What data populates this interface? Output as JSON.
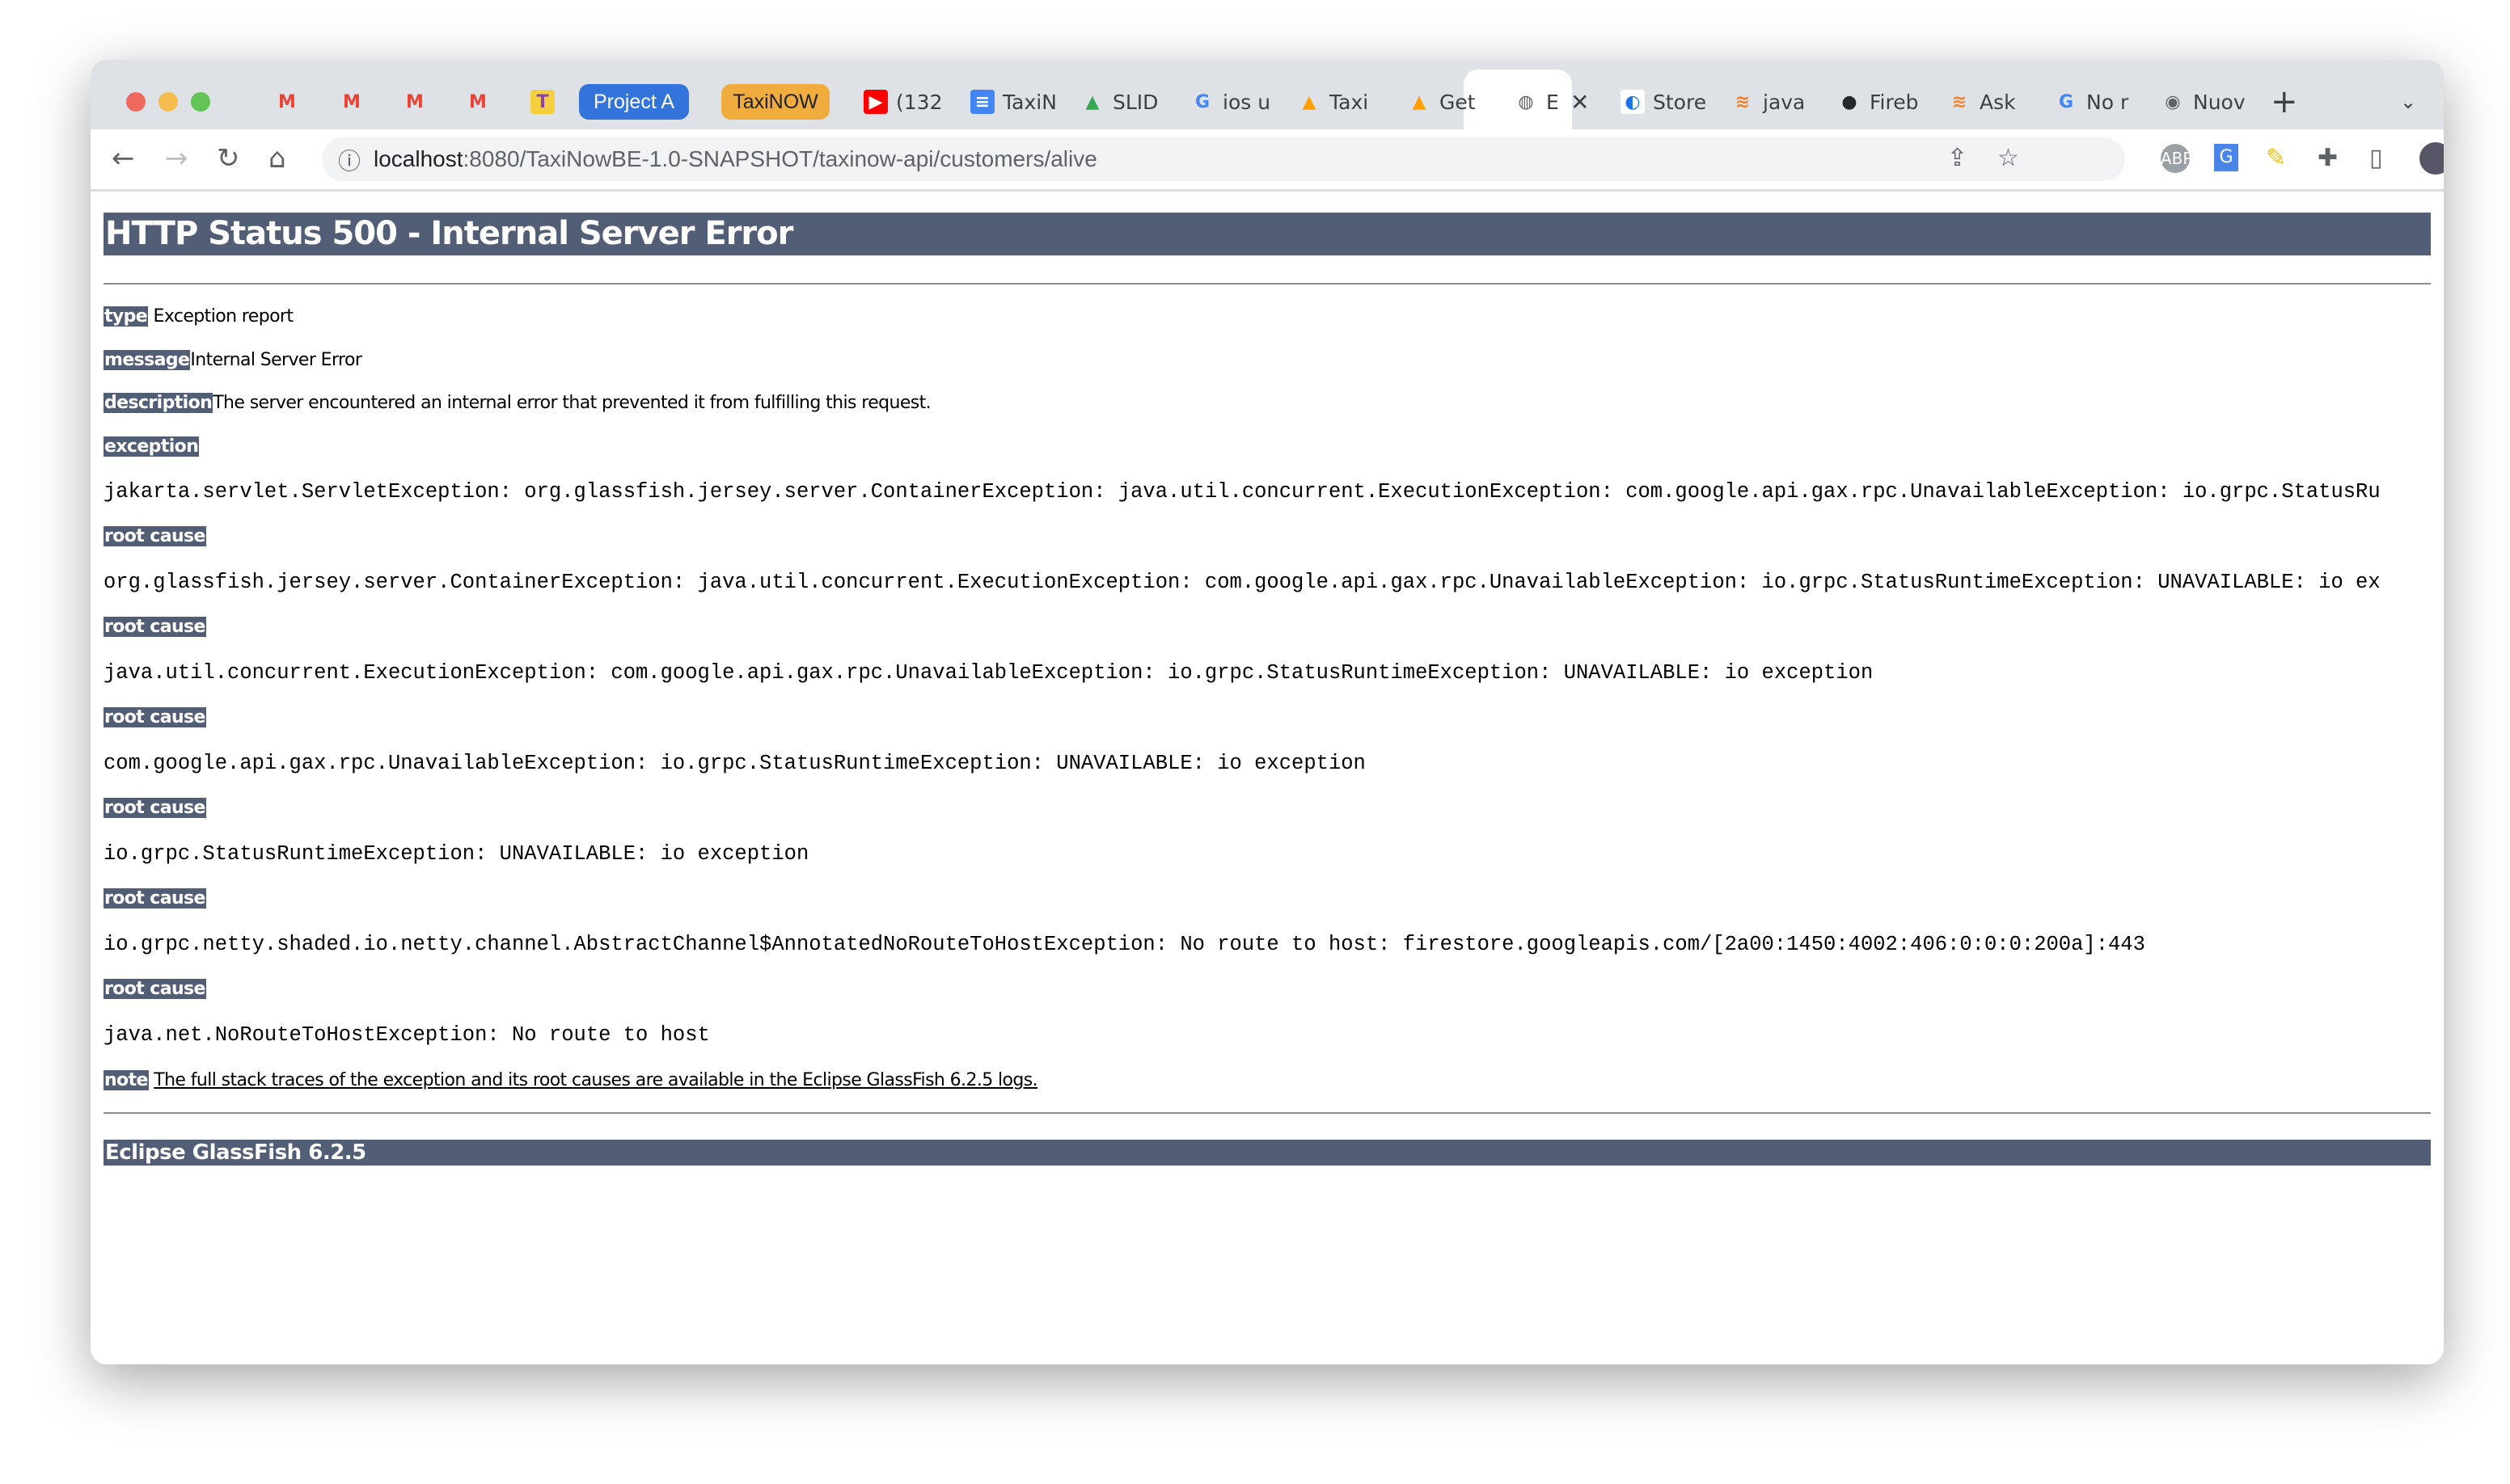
{
  "browser": {
    "tabs": [
      {
        "icon": "gmail-icon",
        "label": ""
      },
      {
        "icon": "gmail-icon",
        "label": ""
      },
      {
        "icon": "gmail-icon",
        "label": ""
      },
      {
        "icon": "gmail-icon",
        "label": ""
      },
      {
        "icon": "t-app-icon",
        "label": ""
      },
      {
        "icon": "youtube-icon",
        "label": "(132"
      },
      {
        "icon": "docs-icon",
        "label": "TaxiN"
      },
      {
        "icon": "drive-icon",
        "label": "SLID"
      },
      {
        "icon": "google-icon",
        "label": "ios u"
      },
      {
        "icon": "firebase-icon",
        "label": "Taxi"
      },
      {
        "icon": "firebase-icon",
        "label": "Get"
      },
      {
        "icon": "globe-icon",
        "label": "E"
      },
      {
        "icon": "storyboard-icon",
        "label": "Store"
      },
      {
        "icon": "stackoverflow-icon",
        "label": "java"
      },
      {
        "icon": "github-icon",
        "label": "Fireb"
      },
      {
        "icon": "stackoverflow-icon",
        "label": "Ask"
      },
      {
        "icon": "google-icon",
        "label": "No r"
      },
      {
        "icon": "chrome-icon",
        "label": "Nuov"
      }
    ],
    "groups": [
      {
        "label": "Project A",
        "color": "#3273dc"
      },
      {
        "label": "TaxiNOW",
        "color": "#f0ad3e"
      }
    ],
    "url_host": "localhost",
    "url_rest": ":8080/TaxiNowBE-1.0-SNAPSHOT/taxinow-api/customers/alive"
  },
  "page": {
    "title": "HTTP Status 500 - Internal Server Error",
    "type_label": "type",
    "type_value": "Exception report",
    "message_label": "message",
    "message_value": "Internal Server Error",
    "description_label": "description",
    "description_value": "The server encountered an internal error that prevented it from fulfilling this request.",
    "exception_label": "exception",
    "exception": "jakarta.servlet.ServletException: org.glassfish.jersey.server.ContainerException: java.util.concurrent.ExecutionException: com.google.api.gax.rpc.UnavailableException: io.grpc.StatusRu",
    "root_cause_label": "root cause",
    "root_causes": [
      "org.glassfish.jersey.server.ContainerException: java.util.concurrent.ExecutionException: com.google.api.gax.rpc.UnavailableException: io.grpc.StatusRuntimeException: UNAVAILABLE: io ex",
      "java.util.concurrent.ExecutionException: com.google.api.gax.rpc.UnavailableException: io.grpc.StatusRuntimeException: UNAVAILABLE: io exception",
      "com.google.api.gax.rpc.UnavailableException: io.grpc.StatusRuntimeException: UNAVAILABLE: io exception",
      "io.grpc.StatusRuntimeException: UNAVAILABLE: io exception",
      "io.grpc.netty.shaded.io.netty.channel.AbstractChannel$AnnotatedNoRouteToHostException: No route to host: firestore.googleapis.com/[2a00:1450:4002:406:0:0:0:200a]:443",
      "java.net.NoRouteToHostException: No route to host"
    ],
    "note_label": "note",
    "note_text": "The full stack traces of the exception and its root causes are available in the Eclipse GlassFish 6.2.5 logs.",
    "footer": "Eclipse GlassFish 6.2.5"
  }
}
